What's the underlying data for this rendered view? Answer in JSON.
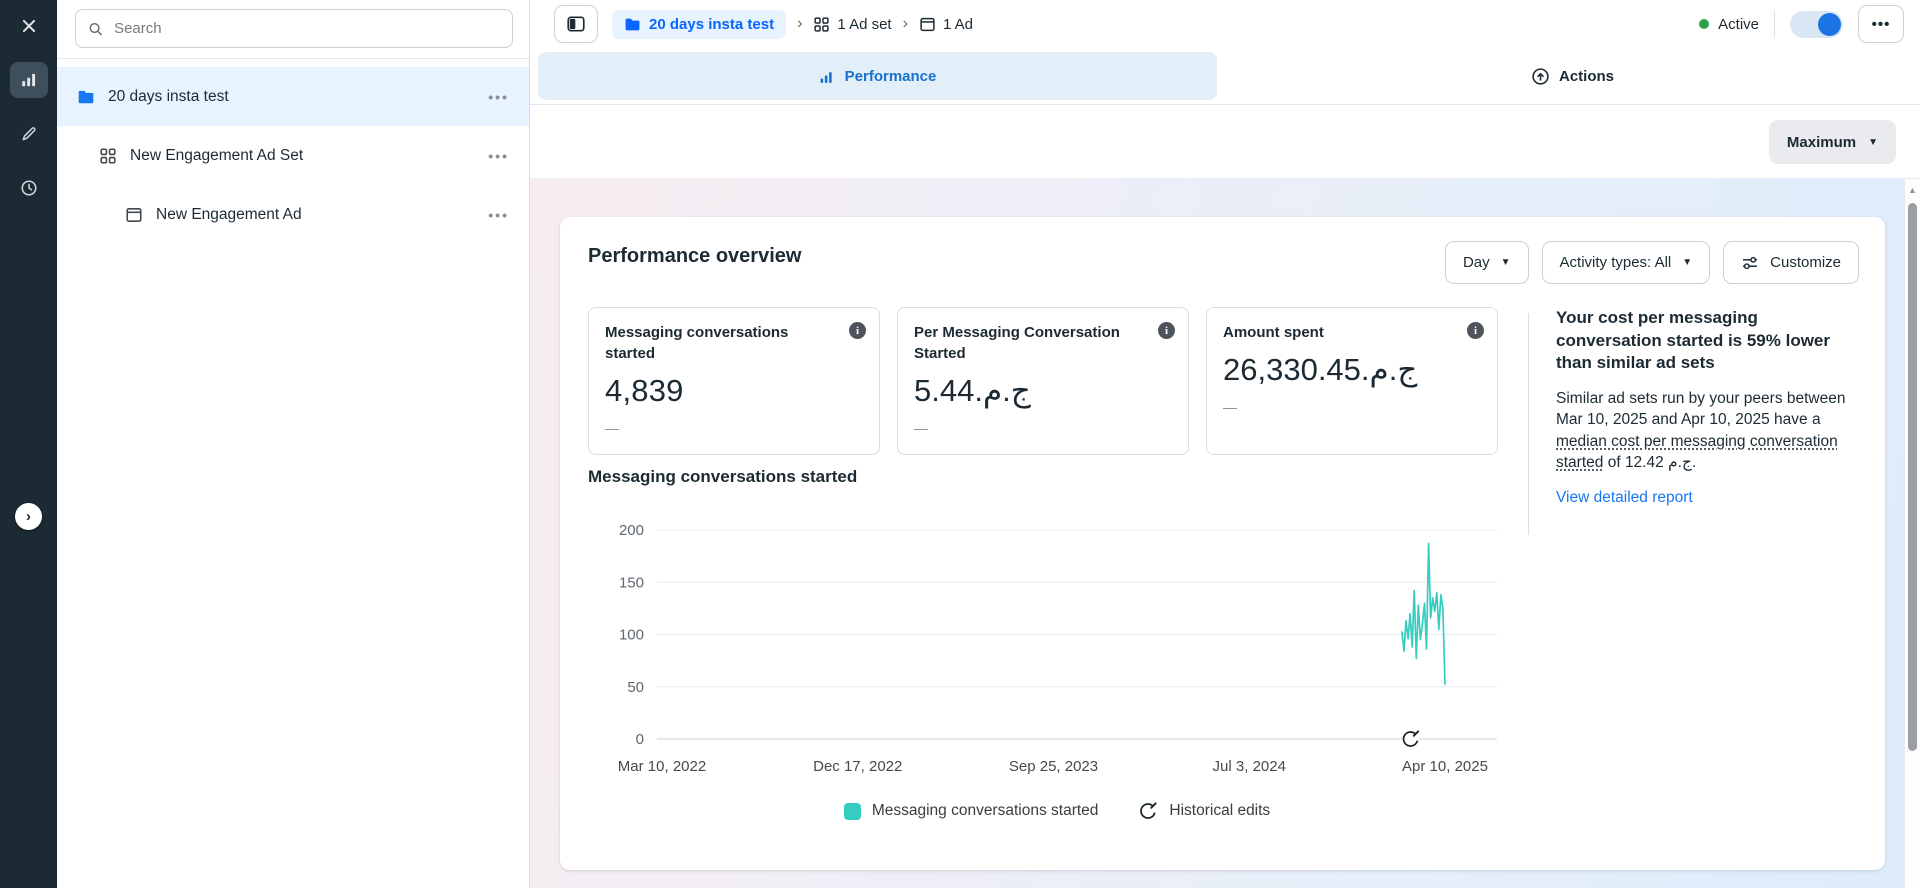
{
  "colors": {
    "accent_blue": "#0866FF",
    "teal": "#35CDC0",
    "active_green": "#31A24C",
    "rail_bg": "#1C2B33",
    "selected_row_bg": "#E7F3FF"
  },
  "tree": {
    "search_placeholder": "Search",
    "items": [
      {
        "label": "20 days insta test",
        "icon": "folder",
        "selected": true,
        "menu": "•••"
      },
      {
        "label": "New Engagement Ad Set",
        "icon": "ad-set-grid",
        "selected": false,
        "menu": "•••"
      },
      {
        "label": "New Engagement Ad",
        "icon": "ad-page",
        "selected": false,
        "menu": "•••"
      }
    ]
  },
  "topbar": {
    "breadcrumb": [
      {
        "label": "20 days insta test",
        "icon": "folder"
      },
      {
        "label": "1 Ad set",
        "icon": "ad-set-grid"
      },
      {
        "label": "1 Ad",
        "icon": "ad-page"
      }
    ],
    "separator": "›",
    "status_label": "Active",
    "more_label": "•••"
  },
  "tabs": {
    "performance": "Performance",
    "actions": "Actions"
  },
  "toolbar": {
    "maximum_label": "Maximum",
    "scroll_up_arrow": "▲"
  },
  "overview": {
    "title": "Performance overview",
    "day_button": "Day",
    "activity_button": "Activity types: All",
    "customize_button": "Customize"
  },
  "metrics": [
    {
      "title": "Messaging conversations started",
      "value": "4,839",
      "delta": "—"
    },
    {
      "title": "Per Messaging Conversation Started",
      "value": "5.44.م.ج",
      "delta": "—"
    },
    {
      "title": "Amount spent",
      "value": "26,330.45.م.ج",
      "delta": "—"
    }
  ],
  "insight": {
    "heading": "Your cost per messaging conversation started is 59% lower than similar ad sets",
    "body_pre": "Similar ad sets run by your peers between Mar 10, 2025 and Apr 10, 2025 have a ",
    "body_underlined": "median cost per messaging conversation started",
    "body_mid": " of ",
    "body_amount": "12.42 م.ج.",
    "link": "View detailed report"
  },
  "chart_data": {
    "type": "line",
    "title": "Messaging conversations started",
    "xlabel": "",
    "ylabel": "",
    "ylim": [
      0,
      200
    ],
    "y_ticks": [
      0,
      50,
      100,
      150,
      200
    ],
    "x_ticks": [
      "Mar 10, 2022",
      "Dec 17, 2022",
      "Sep 25, 2023",
      "Jul 3, 2024",
      "Apr 10, 2025"
    ],
    "grid": true,
    "legend_position": "bottom",
    "legend": [
      "Messaging conversations started",
      "Historical edits"
    ],
    "historical_edit_marker_fraction": 0.956,
    "series": [
      {
        "name": "Messaging conversations started",
        "color": "#35CDC0",
        "x_fraction_range": [
          0.945,
          1.0
        ],
        "values": [
          103,
          84,
          113,
          96,
          120,
          88,
          142,
          77,
          128,
          95,
          110,
          130,
          86,
          187,
          116,
          135,
          122,
          140,
          105,
          138,
          125,
          52
        ]
      }
    ]
  }
}
